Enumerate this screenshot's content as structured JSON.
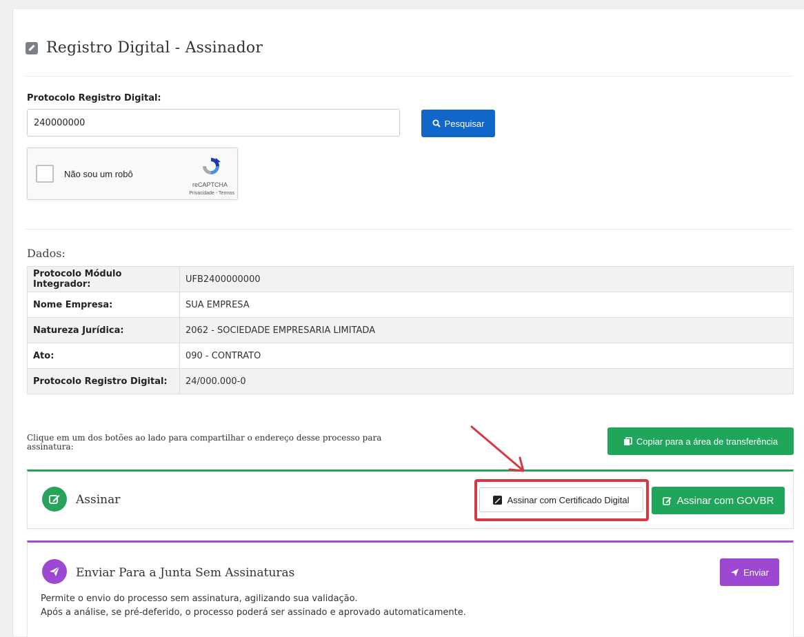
{
  "page": {
    "title": "Registro Digital - Assinador"
  },
  "search": {
    "label": "Protocolo Registro Digital:",
    "value": "240000000",
    "button_label": "Pesquisar"
  },
  "captcha": {
    "label": "Não sou um robô",
    "brand": "reCAPTCHA",
    "links": "Privacidade - Termos"
  },
  "dados": {
    "title": "Dados:",
    "rows": [
      {
        "key": "Protocolo Módulo Integrador:",
        "value": "UFB2400000000"
      },
      {
        "key": "Nome Empresa:",
        "value": "SUA EMPRESA"
      },
      {
        "key": "Natureza Jurídica:",
        "value": "2062 - SOCIEDADE EMPRESARIA LIMITADA"
      },
      {
        "key": "Ato:",
        "value": "090 - CONTRATO"
      },
      {
        "key": "Protocolo Registro Digital:",
        "value": "24/000.000-0"
      }
    ]
  },
  "share": {
    "text": "Clique em um dos botões ao lado para compartilhar o endereço desse processo para assinatura:",
    "copy_label": "Copiar para a área de transferência"
  },
  "sign": {
    "title": "Assinar",
    "cert_label": "Assinar com Certificado Digital",
    "govbr_label": "Assinar com GOVBR"
  },
  "send": {
    "title": "Enviar Para a Junta Sem Assinaturas",
    "button_label": "Enviar",
    "line1": "Permite o envio do processo sem assinatura, agilizando sua validação.",
    "line2": "Após a análise, se pré-deferido, o processo poderá ser assinado e aprovado automaticamente."
  },
  "colors": {
    "primary": "#1167c9",
    "success": "#1fa65a",
    "purple": "#9c48d3",
    "highlight": "#d93743"
  }
}
